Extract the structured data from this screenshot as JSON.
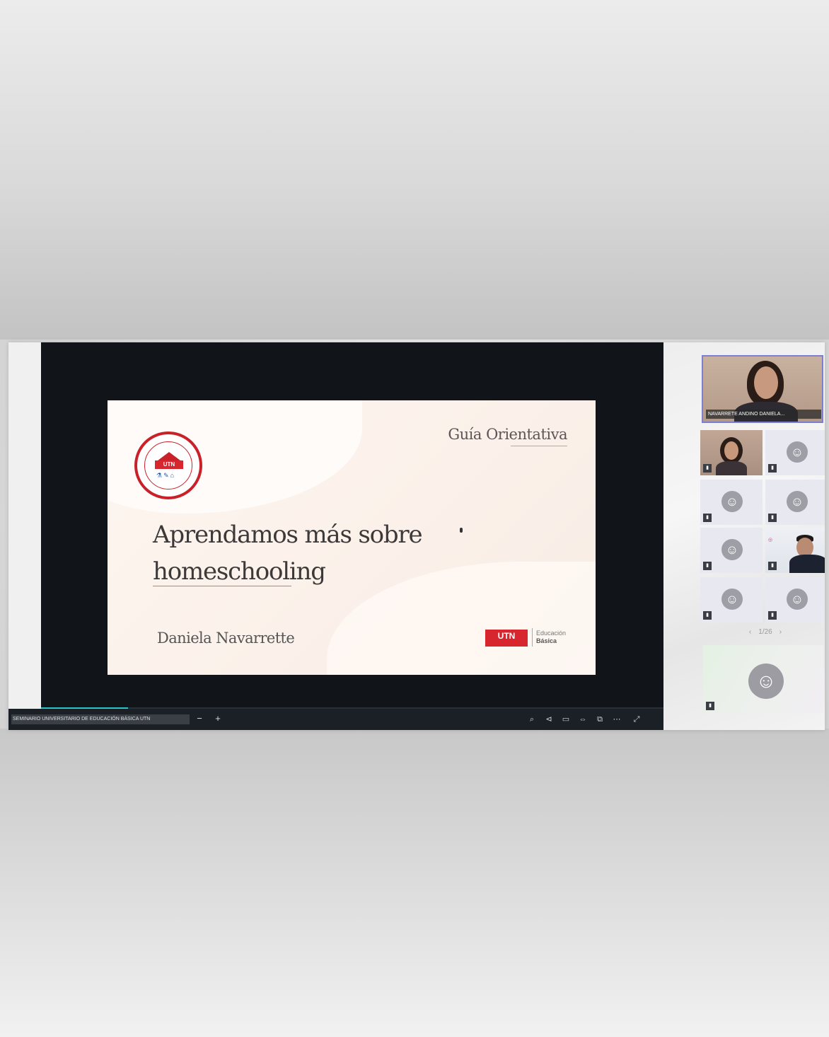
{
  "slide": {
    "tag": "Guía Orientativa",
    "title_line1": "Aprendamos más sobre",
    "title_line2": "homeschooling",
    "author": "Daniela Navarrette",
    "logo_text": "UTN",
    "edu_line1": "Educación",
    "edu_line2": "Básica"
  },
  "seal": {
    "badge": "UTN"
  },
  "toolbar": {
    "caption": "SEMINARIO UNIVERSITARIO DE EDUCACIÓN BÁSICA UTN",
    "zoom_out": "−",
    "zoom_in": "+",
    "icons": [
      "search-icon",
      "share-icon",
      "screen-icon",
      "fit-icon",
      "pip-icon",
      "more-icon",
      "fullscreen-icon"
    ],
    "progress": 0.14
  },
  "participants": {
    "speaker_name": "NAVARRETE ANDINO DANIELA...",
    "pager": "1/26",
    "avatar_glyph": "☺",
    "mic_glyph": "▮"
  },
  "colors": {
    "accent": "#2ec4c7",
    "brand_red": "#d8262f",
    "speaker_border": "#7d7fd1",
    "share_bg": "#111419"
  }
}
